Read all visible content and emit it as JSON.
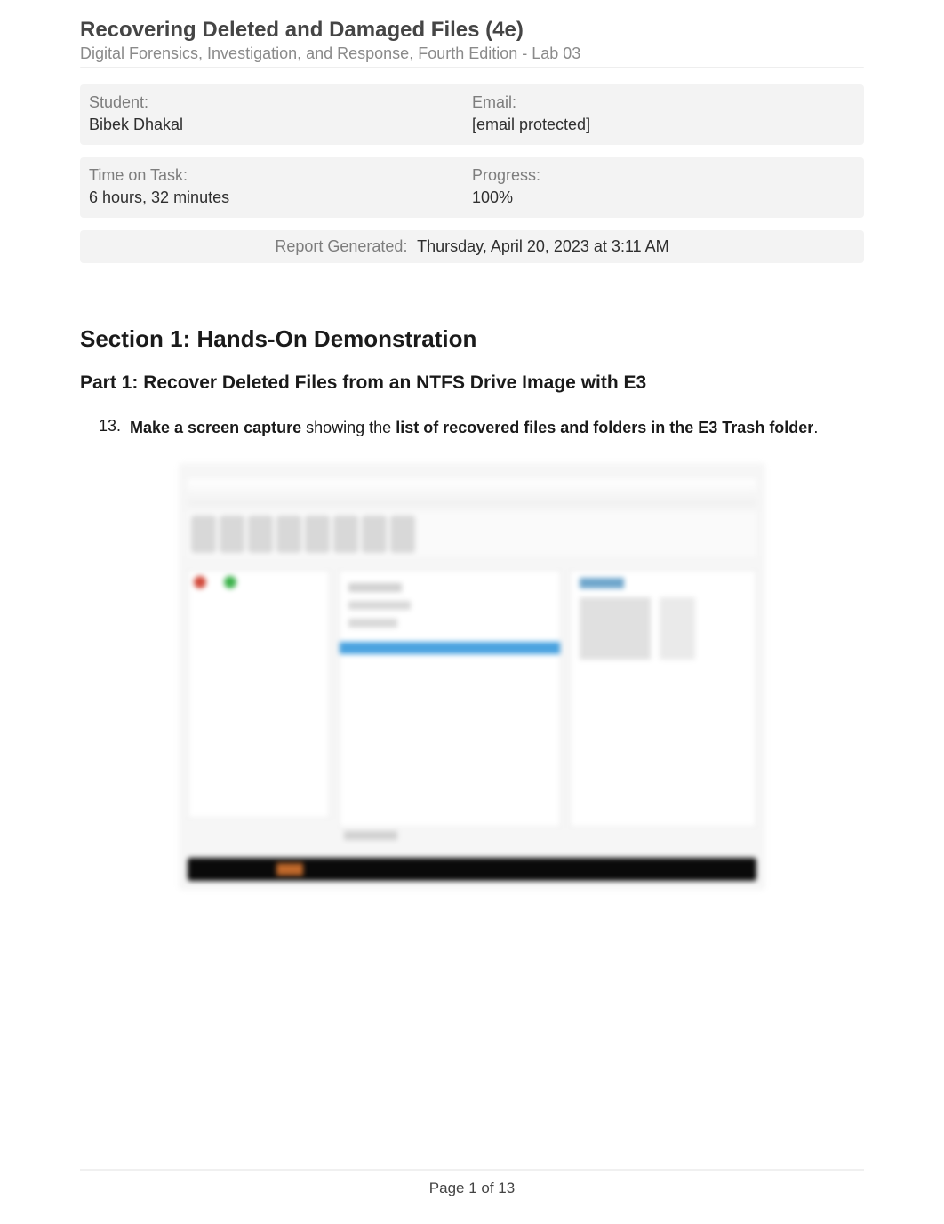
{
  "header": {
    "title": "Recovering Deleted and Damaged Files (4e)",
    "subtitle": "Digital Forensics, Investigation, and Response, Fourth Edition - Lab 03"
  },
  "info": {
    "student_label": "Student:",
    "student_value": "Bibek Dhakal",
    "email_label": "Email:",
    "email_value": "[email protected]",
    "time_label": "Time on Task:",
    "time_value": "6 hours, 32 minutes",
    "progress_label": "Progress:",
    "progress_value": "100%"
  },
  "report": {
    "label": "Report Generated:",
    "value": "Thursday, April 20, 2023 at 3:11 AM"
  },
  "section": {
    "title": "Section 1: Hands-On Demonstration",
    "part_title": "Part 1: Recover Deleted Files from an NTFS Drive Image with E3",
    "item_number": "13.",
    "item_bold1": "Make a screen capture",
    "item_mid": " showing the ",
    "item_bold2": "list of recovered files and folders in the E3 Trash folder",
    "item_end": "."
  },
  "footer": {
    "page": "Page 1 of 13"
  }
}
